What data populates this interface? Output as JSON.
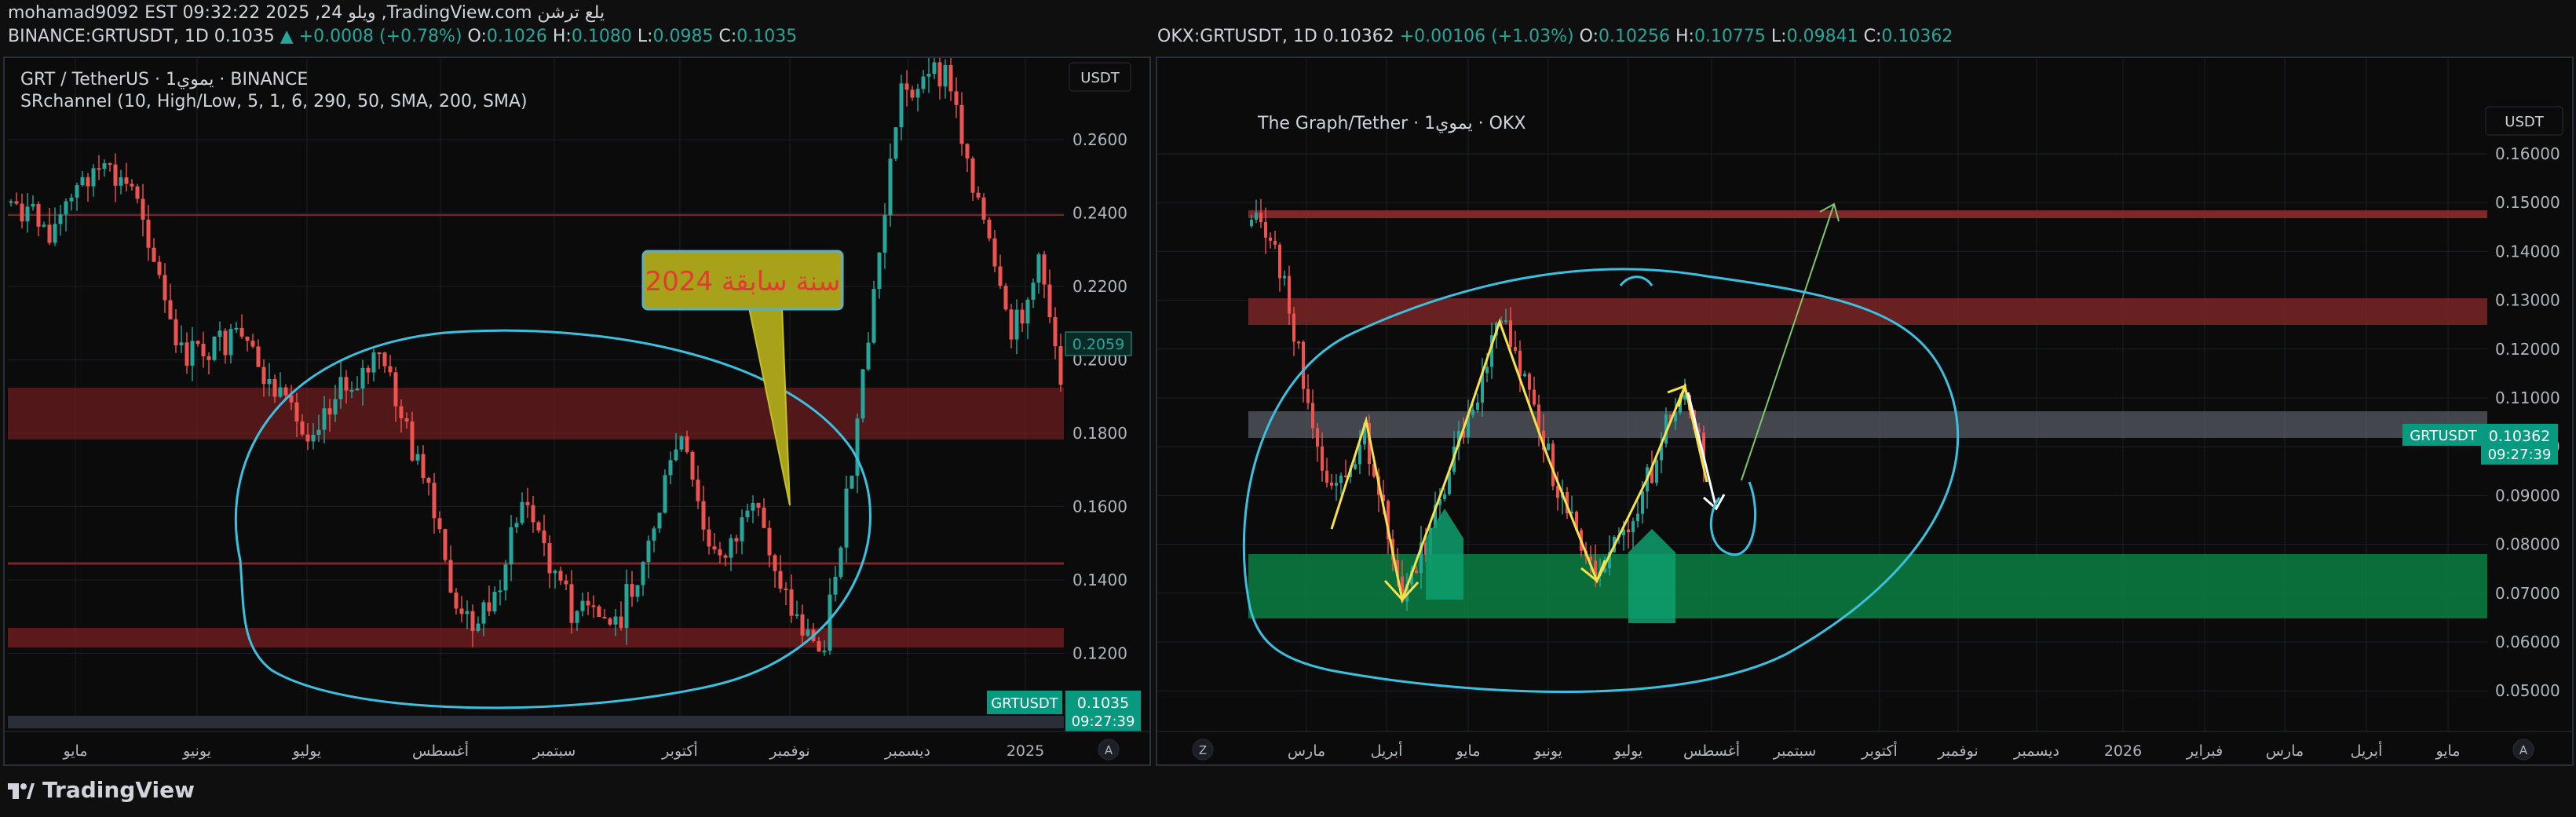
{
  "header": {
    "line1": "mohamad9092 EST 09:32:22 2025 ,24 ويلو ,TradingView.com يلع ترشن",
    "left_symbol": "BINANCE:GRTUSDT, 1D 0.1035",
    "left_change": "▲ +0.0008 (+0.78%)",
    "left_ohlc": {
      "o_label": "O:",
      "o": "0.1026",
      "h_label": "H:",
      "h": "0.1080",
      "l_label": "L:",
      "l": "0.0985",
      "c_label": "C:",
      "c": "0.1035"
    },
    "right_symbol": "OKX:GRTUSDT, 1D 0.10362",
    "right_change": "+0.00106 (+1.03%)",
    "right_ohlc": {
      "o_label": "O:",
      "o": "0.10256",
      "h_label": "H:",
      "h": "0.10775",
      "l_label": "L:",
      "l": "0.09841",
      "c_label": "C:",
      "c": "0.10362"
    }
  },
  "left_chart": {
    "title": "GRT / TetherUS · 1يموي · BINANCE",
    "indicator": "SRchannel (10, High/Low, 5, 1, 6, 290, 50, SMA, 200, SMA)",
    "currency": "USDT",
    "price_ticks": [
      "0.2600",
      "0.2400",
      "0.2200",
      "0.2000",
      "0.1800",
      "0.1600",
      "0.1400",
      "0.1200"
    ],
    "marker_price": "0.2059",
    "last_symbol": "GRTUSDT",
    "last_price": "0.1035",
    "countdown": "09:27:39",
    "time_ticks": [
      "مايو",
      "يونيو",
      "يوليو",
      "أغسطس",
      "سبتمبر",
      "أكتوبر",
      "نوفمبر",
      "ديسمبر",
      "2025"
    ],
    "callout": "سنة سابقة 2024",
    "scale_btn": "A"
  },
  "right_chart": {
    "title": "The Graph/Tether · 1يموي · OKX",
    "currency": "USDT",
    "price_ticks": [
      "0.16000",
      "0.15000",
      "0.14000",
      "0.13000",
      "0.12000",
      "0.11000",
      "0.10000",
      "0.09000",
      "0.08000",
      "0.07000",
      "0.06000",
      "0.05000"
    ],
    "last_symbol": "GRTUSDT",
    "last_price": "0.10362",
    "countdown": "09:27:39",
    "time_ticks": [
      "مارس",
      "أبريل",
      "مايو",
      "يونيو",
      "يوليو",
      "أغسطس",
      "سبتمبر",
      "أكتوبر",
      "نوفمبر",
      "ديسمبر",
      "2026",
      "فبراير",
      "مارس",
      "أبريل",
      "مايو"
    ],
    "zoom_btn": "Z",
    "scale_btn": "A"
  },
  "footer": {
    "brand": "TradingView"
  },
  "colors": {
    "up": "#26a69a",
    "down": "#ef5350",
    "zone_red": "#7a1f22",
    "zone_green": "#0b8043",
    "zone_gray": "#5d606b",
    "cyan": "#3bc1e0",
    "yellow": "#f7e14b"
  }
}
